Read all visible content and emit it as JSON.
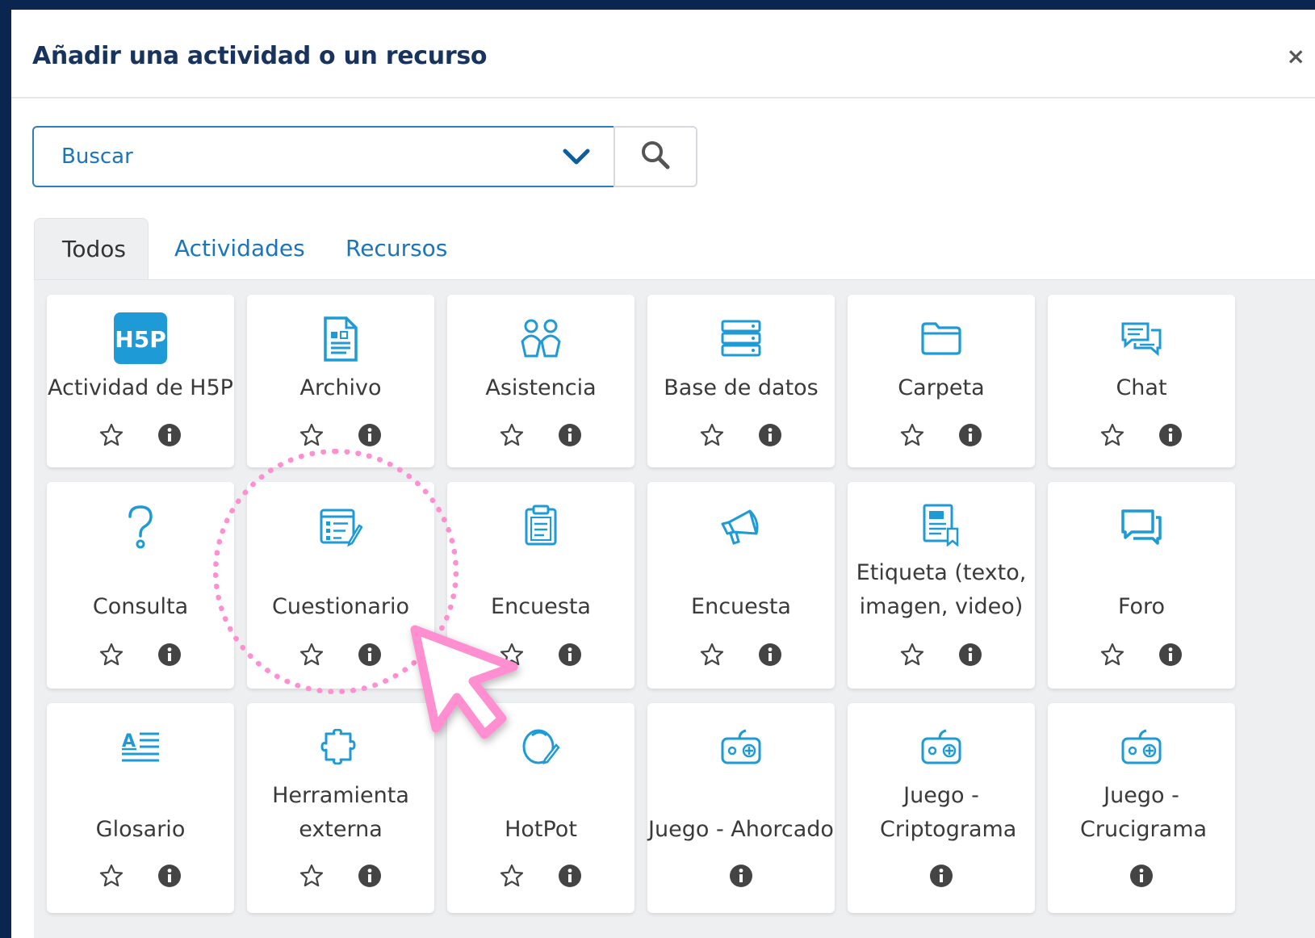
{
  "modal": {
    "title": "Añadir una actividad o un recurso",
    "close_label": "×"
  },
  "search": {
    "placeholder": "Buscar",
    "icon": "search-icon",
    "dropdown_icon": "chevron-down-icon"
  },
  "tabs": [
    {
      "label": "Todos",
      "active": true
    },
    {
      "label": "Actividades",
      "active": false
    },
    {
      "label": "Recursos",
      "active": false
    }
  ],
  "colors": {
    "accent": "#1b75bb",
    "icon": "#1e9ad6",
    "title": "#17335e",
    "highlight": "#ff8fd0",
    "background": "#0b2551"
  },
  "items": [
    {
      "label": "Actividad de H5P",
      "icon": "h5p-icon",
      "star": true
    },
    {
      "label": "Archivo",
      "icon": "file-icon",
      "star": true
    },
    {
      "label": "Asistencia",
      "icon": "attendance-icon",
      "star": true
    },
    {
      "label": "Base de datos",
      "icon": "database-icon",
      "star": true
    },
    {
      "label": "Carpeta",
      "icon": "folder-icon",
      "star": true
    },
    {
      "label": "Chat",
      "icon": "chat-icon",
      "star": true
    },
    {
      "label": "Consulta",
      "icon": "question-icon",
      "star": true
    },
    {
      "label": "Cuestionario",
      "icon": "quiz-icon",
      "star": true
    },
    {
      "label": "Encuesta",
      "icon": "clipboard-icon",
      "star": true
    },
    {
      "label": "Encuesta",
      "icon": "megaphone-icon",
      "star": true
    },
    {
      "label": "Etiqueta (texto, imagen, video)",
      "icon": "label-icon",
      "star": true
    },
    {
      "label": "Foro",
      "icon": "forum-icon",
      "star": true
    },
    {
      "label": "Glosario",
      "icon": "glossary-icon",
      "star": true
    },
    {
      "label": "Herramienta externa",
      "icon": "puzzle-icon",
      "star": true
    },
    {
      "label": "HotPot",
      "icon": "hotpot-icon",
      "star": true
    },
    {
      "label": "Juego - Ahorcado",
      "icon": "gamepad-icon",
      "star": false
    },
    {
      "label": "Juego - Criptograma",
      "icon": "gamepad-icon",
      "star": false
    },
    {
      "label": "Juego - Crucigrama",
      "icon": "gamepad-icon",
      "star": false
    }
  ]
}
